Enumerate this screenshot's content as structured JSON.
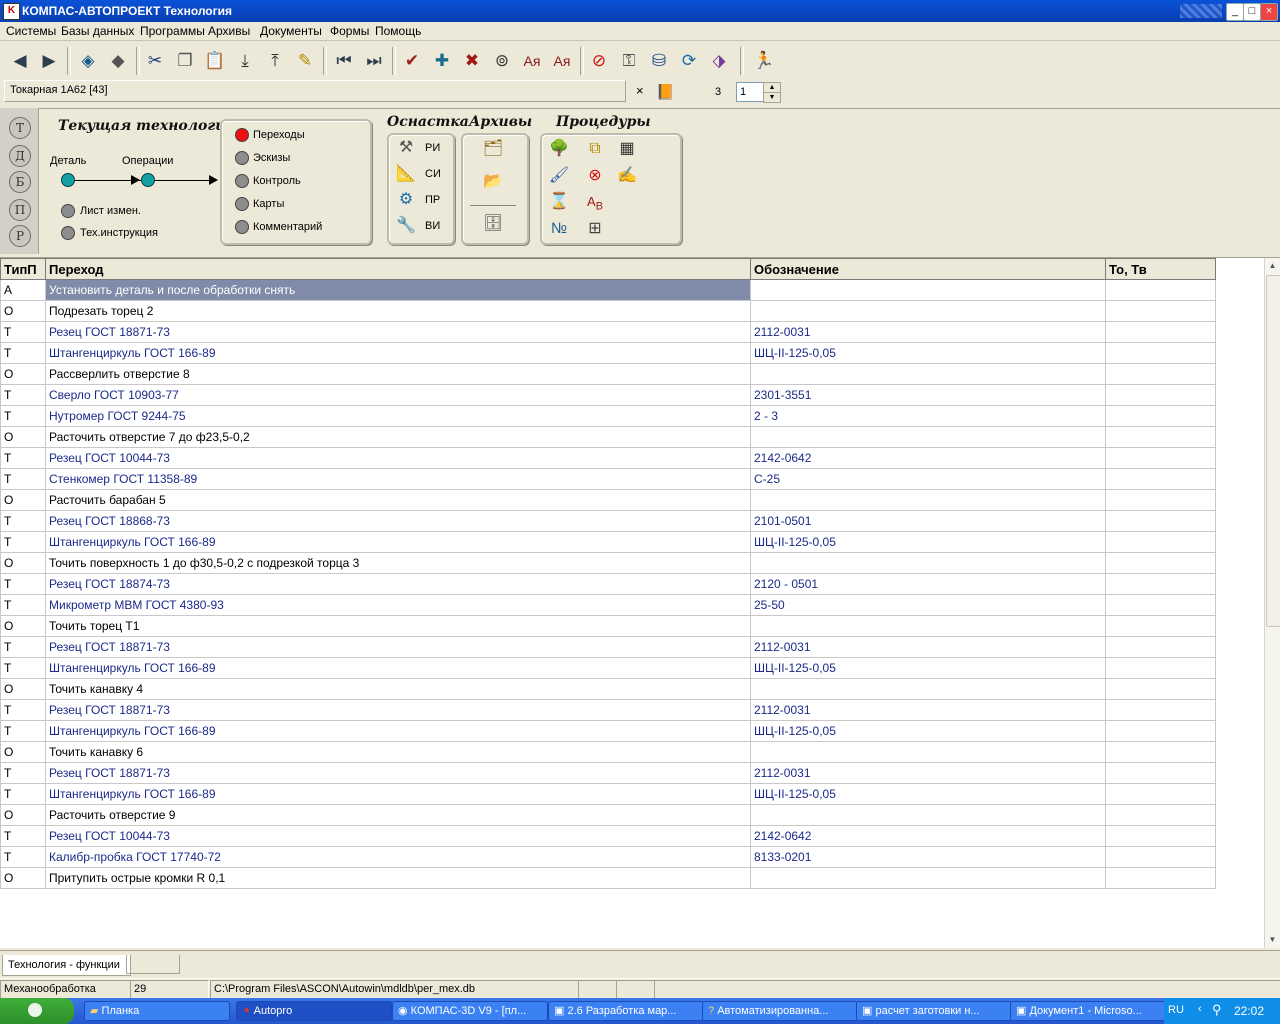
{
  "window": {
    "title": "КОМПАС-АВТОПРОЕКТ Технология"
  },
  "menu": [
    "Системы",
    "Базы данных",
    "Программы",
    "Архивы",
    "Документы",
    "Формы",
    "Помощь"
  ],
  "context": {
    "field": "Токарная 1А62  [43]",
    "count": "3",
    "spin_value": "1",
    "close": "×"
  },
  "left_strip": [
    "Т",
    "Д",
    "Б",
    "П",
    "Р"
  ],
  "current_tech": {
    "title": "Текущая технология",
    "detail": "Деталь",
    "operations": "Операции",
    "list_changes": "Лист измен.",
    "tech_instr": "Тех.инструкция"
  },
  "transitions_panel": [
    "Переходы",
    "Эскизы",
    "Контроль",
    "Карты",
    "Комментарий"
  ],
  "headers": {
    "osnastka": "Оснастка",
    "archives": "Архивы",
    "procedures": "Процедуры"
  },
  "osnastka": [
    "РИ",
    "СИ",
    "ПР",
    "ВИ"
  ],
  "table": {
    "columns": [
      "ТипП",
      "Переход",
      "Обозначение",
      "То, Тв"
    ],
    "rows": [
      {
        "t": "А",
        "d": "Установить деталь и после обработки снять",
        "o": ""
      },
      {
        "t": "О",
        "d": "Подрезать торец 2",
        "o": ""
      },
      {
        "t": "Т",
        "d": "Резец    ГОСТ 18871-73",
        "o": "2112-0031"
      },
      {
        "t": "Т",
        "d": "Штангенциркуль ГОСТ 166-89",
        "o": "ШЦ-II-125-0,05"
      },
      {
        "t": "О",
        "d": "Рассверлить отверстие 8",
        "o": ""
      },
      {
        "t": "Т",
        "d": "Сверло    ГОСТ 10903-77",
        "o": "2301-3551"
      },
      {
        "t": "Т",
        "d": "Нутромер  ГОСТ 9244-75",
        "o": "2 - 3"
      },
      {
        "t": "О",
        "d": "Расточить отверстие 7 до ф23,5-0,2",
        "o": ""
      },
      {
        "t": "Т",
        "d": "Резец  ГОСТ 10044-73",
        "o": "2142-0642"
      },
      {
        "t": "Т",
        "d": "Стенкомер  ГОСТ 11358-89",
        "o": "С-25"
      },
      {
        "t": "О",
        "d": "Расточить барабан 5",
        "o": ""
      },
      {
        "t": "Т",
        "d": "Резец   ГОСТ 18868-73",
        "o": "2101-0501"
      },
      {
        "t": "Т",
        "d": "Штангенциркуль ГОСТ 166-89",
        "o": "ШЦ-II-125-0,05"
      },
      {
        "t": "О",
        "d": "Точить поверхность 1 до ф30,5-0,2 с подрезкой торца 3",
        "o": ""
      },
      {
        "t": "Т",
        "d": "Резец    ГОСТ 18874-73",
        "o": "2120 - 0501"
      },
      {
        "t": "Т",
        "d": "Микрометр  МВМ  ГОСТ 4380-93",
        "o": "25-50"
      },
      {
        "t": "О",
        "d": "Точить торец Т1",
        "o": ""
      },
      {
        "t": "Т",
        "d": "Резец    ГОСТ 18871-73",
        "o": "2112-0031"
      },
      {
        "t": "Т",
        "d": "Штангенциркуль ГОСТ 166-89",
        "o": "ШЦ-II-125-0,05"
      },
      {
        "t": "О",
        "d": "Точить канавку 4",
        "o": ""
      },
      {
        "t": "Т",
        "d": "Резец    ГОСТ 18871-73",
        "o": "2112-0031"
      },
      {
        "t": "Т",
        "d": "Штангенциркуль ГОСТ 166-89",
        "o": "ШЦ-II-125-0,05"
      },
      {
        "t": "О",
        "d": "Точить канавку 6",
        "o": ""
      },
      {
        "t": "Т",
        "d": "Резец    ГОСТ 18871-73",
        "o": "2112-0031"
      },
      {
        "t": "Т",
        "d": "Штангенциркуль ГОСТ 166-89",
        "o": "ШЦ-II-125-0,05"
      },
      {
        "t": "О",
        "d": "Расточить отверстие 9",
        "o": ""
      },
      {
        "t": "Т",
        "d": "Резец  ГОСТ 10044-73",
        "o": "2142-0642"
      },
      {
        "t": "Т",
        "d": "Калибр-пробка  ГОСТ 17740-72",
        "o": "8133-0201"
      },
      {
        "t": "О",
        "d": "Притупить острые кромки R 0,1",
        "o": ""
      }
    ]
  },
  "tab": "Технология - функции",
  "status": {
    "mode": "Механообработка",
    "num": "29",
    "path": "C:\\Program Files\\ASCON\\Autowin\\mdldb\\per_mex.db"
  },
  "taskbar": {
    "items": [
      "Планка",
      "Autopro",
      "КОМПАС-3D V9 - [пл...",
      "2.6 Разработка мар...",
      "Автоматизированна...",
      "расчет заготовки н...",
      "Документ1 - Microso..."
    ],
    "lang": "RU",
    "time": "22:02"
  }
}
